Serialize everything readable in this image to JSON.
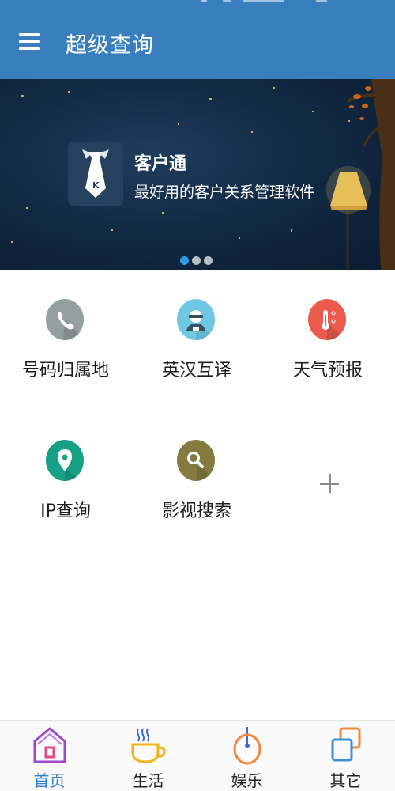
{
  "appbar": {
    "title": "超级查询"
  },
  "banner": {
    "title": "客户通",
    "subtitle": "最好用的客户关系管理软件",
    "logo_letter": "K",
    "page_count": 3,
    "active_page": 1
  },
  "grid": {
    "items": [
      {
        "label": "号码归属地",
        "icon": "phone-icon",
        "color": "#959ea0"
      },
      {
        "label": "英汉互译",
        "icon": "translator-icon",
        "color": "#6ec8e4"
      },
      {
        "label": "天气预报",
        "icon": "thermometer-icon",
        "color": "#ea5b4e"
      },
      {
        "label": "IP查询",
        "icon": "location-pin-icon",
        "color": "#16a085"
      },
      {
        "label": "影视搜索",
        "icon": "search-icon",
        "color": "#857a40"
      }
    ],
    "add_icon": "plus-icon"
  },
  "bottom_nav": {
    "items": [
      {
        "label": "首页",
        "icon": "home-icon",
        "active": true
      },
      {
        "label": "生活",
        "icon": "coffee-cup-icon",
        "active": false
      },
      {
        "label": "娱乐",
        "icon": "mouse-icon",
        "active": false
      },
      {
        "label": "其它",
        "icon": "copy-icon",
        "active": false
      }
    ]
  },
  "colors": {
    "appbar": "#3a7fbd",
    "active_nav": "#2d7fd0",
    "active_dot": "#2d9be3"
  }
}
